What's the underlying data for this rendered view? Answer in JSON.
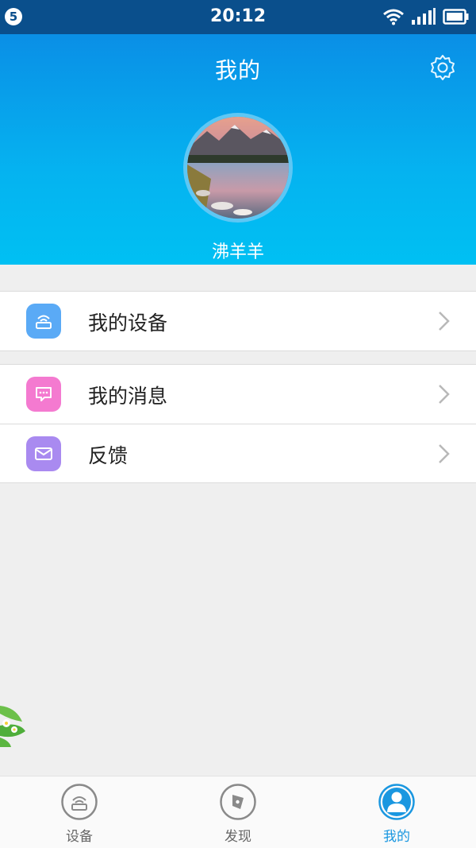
{
  "status_bar": {
    "badge": "5",
    "time": "20:12",
    "icons": [
      "wifi-icon",
      "signal-icon",
      "battery-icon"
    ]
  },
  "header": {
    "title": "我的",
    "username": "沸羊羊",
    "settings_icon": "gear-icon"
  },
  "menu": {
    "groups": [
      [
        {
          "label": "我的设备",
          "icon": "router-icon",
          "color": "#5aaaf6"
        }
      ],
      [
        {
          "label": "我的消息",
          "icon": "message-icon",
          "color": "#f47ad0"
        },
        {
          "label": "反馈",
          "icon": "mail-icon",
          "color": "#a98af0"
        }
      ]
    ]
  },
  "bottom_nav": {
    "items": [
      {
        "label": "设备",
        "icon": "router-icon",
        "active": false
      },
      {
        "label": "发现",
        "icon": "compass-icon",
        "active": false
      },
      {
        "label": "我的",
        "icon": "person-icon",
        "active": true
      }
    ]
  },
  "colors": {
    "accent": "#1a97e0",
    "header_top": "#0a8fe6",
    "header_bottom": "#00c0f3",
    "status_bar": "#0a4f8c",
    "background": "#efefef"
  }
}
